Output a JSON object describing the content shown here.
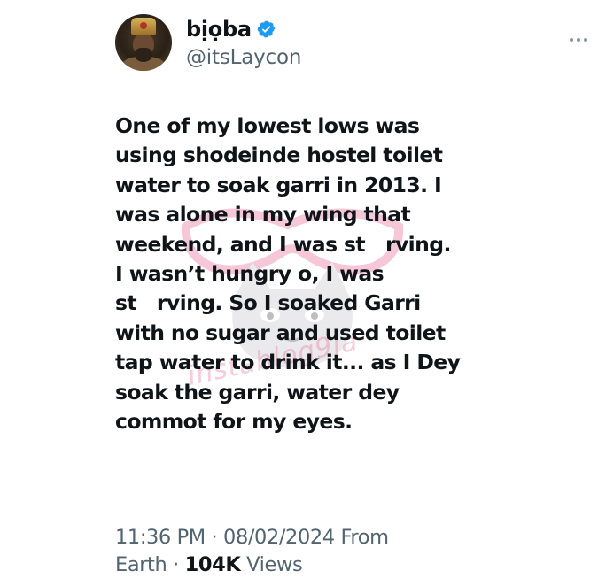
{
  "user": {
    "display_name": "bịọba",
    "handle": "@itsLaycon"
  },
  "tweet": {
    "lines": [
      "One of my lowest lows was",
      "using shodeinde hostel toilet",
      "water to soak garri in 2013. I",
      "was alone in my wing that",
      "weekend, and I was st rving.",
      "I wasn’t hungry o, I was",
      "st rving. So I soaked Garri",
      "with no sugar and used toilet",
      "tap water to drink it... as I Dey",
      "soak the garri, water dey",
      "commot for my eyes."
    ]
  },
  "meta": {
    "line1": "11:36 PM · 08/02/2024 From",
    "line2_prefix": "Earth · ",
    "views_count": "104K",
    "views_label": " Views"
  },
  "watermark": {
    "text": "instablog9ja"
  },
  "icons": {
    "verified": "verified-badge-icon",
    "more": "more-options-icon"
  },
  "colors": {
    "verified_blue": "#1d9bf0",
    "text_primary": "#0f1419",
    "text_secondary": "#536471",
    "watermark_pink": "#e86e96"
  }
}
